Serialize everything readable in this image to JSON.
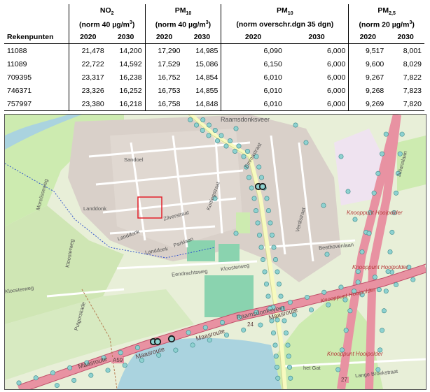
{
  "table": {
    "col_rekenpunten": "Rekenpunten",
    "groups": [
      {
        "name": "NO",
        "sub": "2",
        "norm_pre": "(norm 40 µg/m",
        "norm_sup": "3",
        "norm_post": ")"
      },
      {
        "name": "PM",
        "sub": "10",
        "norm_pre": "(norm 40 µg/m",
        "norm_sup": "3",
        "norm_post": ")"
      },
      {
        "name": "PM",
        "sub": "10",
        "norm_pre": "(norm overschr.dgn 35 dgn)",
        "norm_sup": "",
        "norm_post": ""
      },
      {
        "name": "PM",
        "sub": "2,5",
        "norm_pre": "(norm 20 µg/m",
        "norm_sup": "3",
        "norm_post": ")"
      }
    ],
    "year_a": "2020",
    "year_b": "2030",
    "rows": [
      {
        "id": "11088",
        "v": [
          "21,478",
          "14,200",
          "17,290",
          "14,985",
          "6,090",
          "6,000",
          "9,517",
          "8,001"
        ]
      },
      {
        "id": "11089",
        "v": [
          "22,722",
          "14,592",
          "17,529",
          "15,086",
          "6,150",
          "6,000",
          "9,600",
          "8,029"
        ]
      },
      {
        "id": "709395",
        "v": [
          "23,317",
          "16,238",
          "16,752",
          "14,854",
          "6,010",
          "6,000",
          "9,267",
          "7,822"
        ]
      },
      {
        "id": "746371",
        "v": [
          "23,326",
          "16,252",
          "16,753",
          "14,855",
          "6,010",
          "6,000",
          "9,268",
          "7,823"
        ]
      },
      {
        "id": "757997",
        "v": [
          "23,380",
          "16,218",
          "16,758",
          "14,848",
          "6,010",
          "6,000",
          "9,269",
          "7,820"
        ]
      }
    ]
  },
  "map": {
    "labels": {
      "raamsdonksveer_top": "Raamsdonksveer",
      "raamsdonksveer_mid": "Raamsdonksveer",
      "knooppunt1": "Knooppunt Hooipolder",
      "knooppunt2": "Knooppunt Hooipolder",
      "knooppunt3": "Knooppunt Hooipolder",
      "knooppunt4": "Knooppunt Hooipolder",
      "maasroute1": "Maasroute",
      "maasroute2": "Maasroute",
      "maasroute3": "Maasroute",
      "maasroute4": "Maasroute",
      "a59": "A59",
      "eendrachtsweg": "Eendrachtsweg",
      "kloosterweg1": "Kloosterweg",
      "kloosterweg2": "Kloosterweg",
      "kloosterweg3": "Kloosterweg",
      "beethovenlaan": "Beethovenlaan",
      "julianalaan": "Julianalaan",
      "lange_broekstraat": "Lange Broekstraat",
      "het_gat": "het Gat",
      "morelisseweg": "Morelisseweg",
      "sandoel": "Sandoel",
      "landdonk1": "Landdonk",
      "landdonk2": "Landdonk",
      "landdonk3": "Landdonk",
      "parklaan": "Parklaan",
      "zilverstraat": "Zilverstraat",
      "kortingstraat": "Kortingstraat",
      "verdistraat": "Verdistraat",
      "emmastraat": "Emmastraat",
      "putgorskade": "Putgorskade",
      "r27": "27",
      "r24": "24"
    },
    "colors": {
      "motorway": "#e892a2",
      "main_road": "#f7fabf",
      "residential": "#ffffff",
      "buildings": "#d9d0c9",
      "grass": "#cdebb0",
      "water": "#aad3df",
      "sports": "#8ad3af",
      "receptor_marker": "#8ed1d0",
      "highlight_marker": "#1a1a1a",
      "study_area": "#e2202b"
    }
  }
}
